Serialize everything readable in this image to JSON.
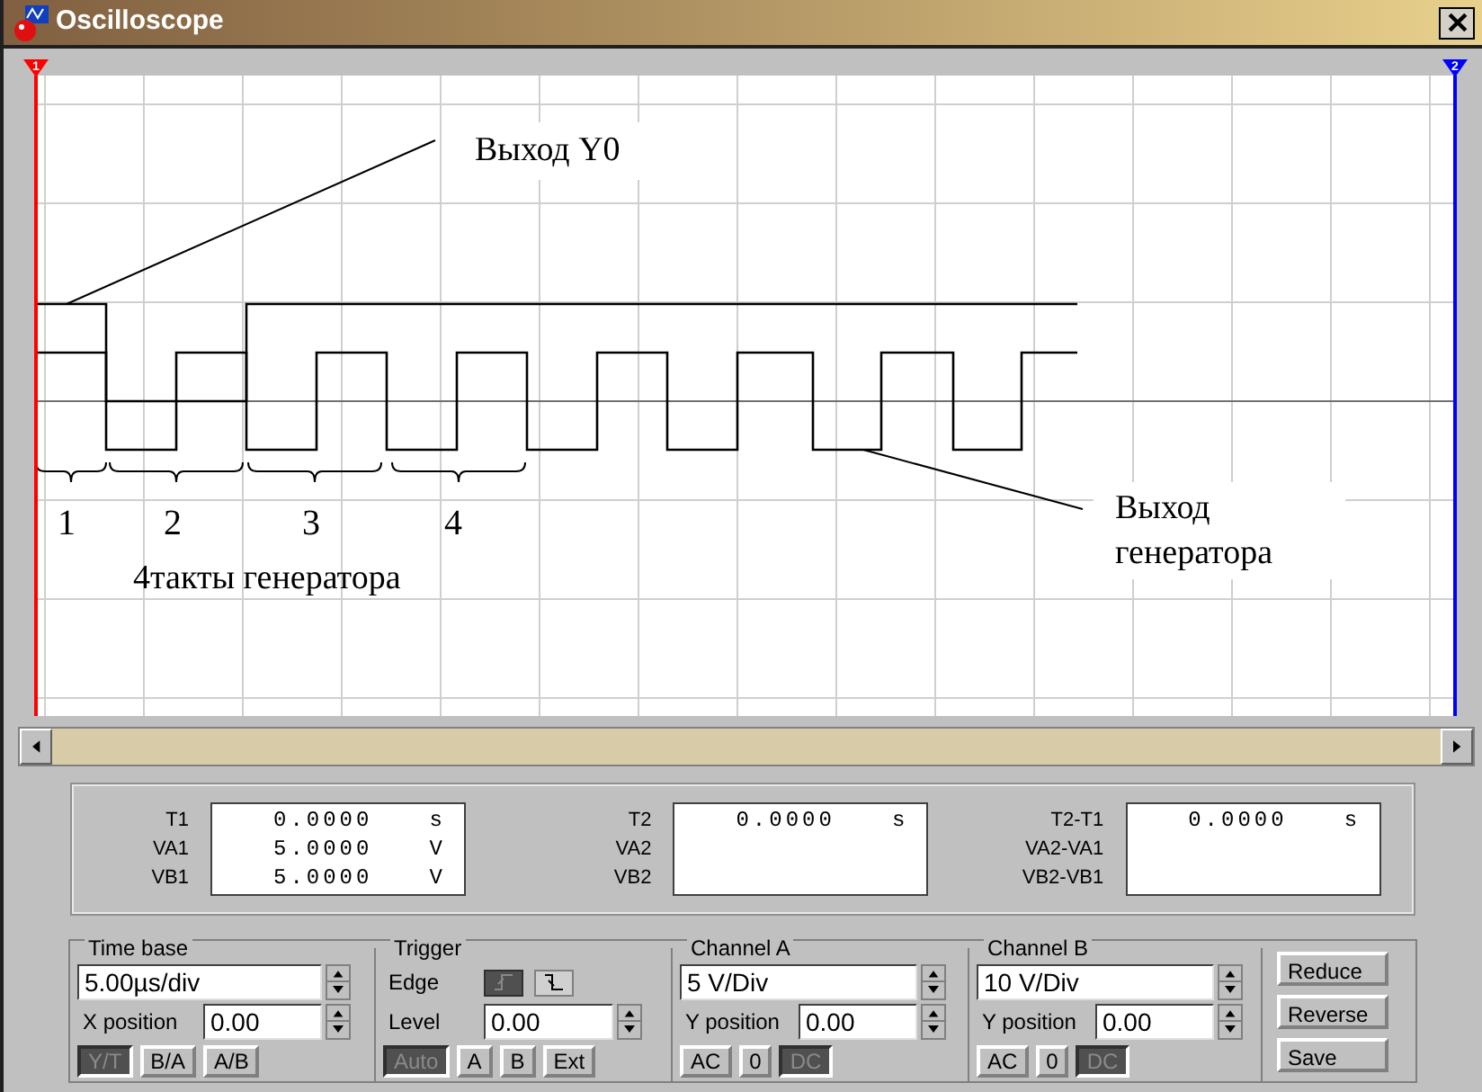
{
  "window": {
    "title": "Oscilloscope"
  },
  "cursors": [
    {
      "label": "1",
      "color": "#ff0000"
    },
    {
      "label": "2",
      "color": "#0000ff"
    }
  ],
  "screen": {
    "callout_top": "Выход Y0",
    "callout_bottom": "Выход генератора",
    "clock_numbers": [
      "1",
      "2",
      "3",
      "4"
    ],
    "caption": "4такты генератора"
  },
  "readouts": [
    {
      "labels": [
        "T1",
        "VA1",
        "VB1"
      ],
      "values": [
        "0.0000",
        "5.0000",
        "5.0000"
      ],
      "units": [
        "s",
        "V",
        "V"
      ]
    },
    {
      "labels": [
        "T2",
        "VA2",
        "VB2"
      ],
      "values": [
        "0.0000"
      ],
      "units": [
        "s"
      ]
    },
    {
      "labels": [
        "T2-T1",
        "VA2-VA1",
        "VB2-VB1"
      ],
      "values": [
        "0.0000"
      ],
      "units": [
        "s"
      ]
    }
  ],
  "time_base": {
    "title": "Time base",
    "scale": "5.00µs/div",
    "x_label": "X position",
    "x_value": "0.00",
    "modes": [
      {
        "label": "Y/T",
        "selected": true
      },
      {
        "label": "B/A",
        "selected": false
      },
      {
        "label": "A/B",
        "selected": false
      }
    ]
  },
  "trigger": {
    "title": "Trigger",
    "edge_label": "Edge",
    "edges": [
      {
        "kind": "rising",
        "selected": true
      },
      {
        "kind": "falling",
        "selected": false
      }
    ],
    "level_label": "Level",
    "level_value": "0.00",
    "sources": [
      {
        "label": "Auto",
        "selected": true
      },
      {
        "label": "A",
        "selected": false
      },
      {
        "label": "B",
        "selected": false
      },
      {
        "label": "Ext",
        "selected": false
      }
    ]
  },
  "channels": [
    {
      "title": "Channel A",
      "scale": "5 V/Div",
      "y_label": "Y position",
      "y_value": "0.00",
      "couplings": [
        {
          "label": "AC",
          "selected": false
        },
        {
          "label": "0",
          "selected": false
        },
        {
          "label": "DC",
          "selected": true
        }
      ]
    },
    {
      "title": "Channel B",
      "scale": "10 V/Div",
      "y_label": "Y position",
      "y_value": "0.00",
      "couplings": [
        {
          "label": "AC",
          "selected": false
        },
        {
          "label": "0",
          "selected": false
        },
        {
          "label": "DC",
          "selected": true
        }
      ]
    }
  ],
  "buttons": [
    "Reduce",
    "Reverse",
    "Save"
  ]
}
